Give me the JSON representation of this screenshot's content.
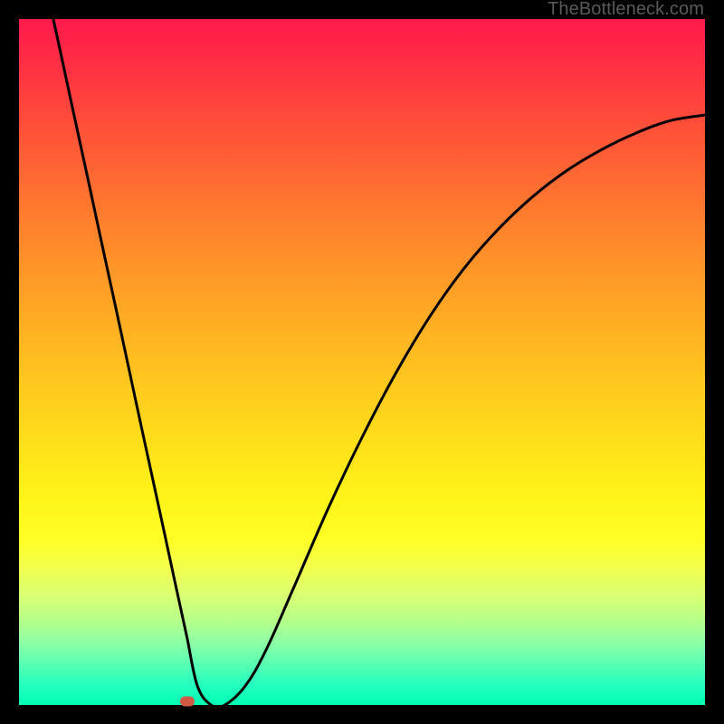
{
  "watermark": "TheBottleneck.com",
  "chart_data": {
    "type": "line",
    "title": "",
    "xlabel": "",
    "ylabel": "",
    "xlim": [
      0,
      100
    ],
    "ylim": [
      0,
      100
    ],
    "series": [
      {
        "name": "curve",
        "x": [
          5.0,
          6,
          8,
          10,
          12,
          14,
          16,
          18,
          20,
          21.3,
          22.5,
          23.5,
          24.5,
          26,
          28,
          30,
          33,
          36,
          40,
          45,
          50,
          55,
          60,
          65,
          70,
          75,
          80,
          85,
          90,
          95,
          100
        ],
        "y": [
          100,
          95.4,
          86.1,
          76.9,
          67.6,
          58.4,
          49.1,
          39.8,
          30.6,
          24.6,
          19.0,
          14.4,
          9.8,
          2.8,
          0.0,
          0.0,
          2.8,
          8.0,
          17.0,
          28.5,
          39.0,
          48.5,
          56.8,
          63.8,
          69.5,
          74.2,
          78.0,
          81.0,
          83.4,
          85.2,
          86.0
        ]
      }
    ],
    "marker": {
      "x": 24.5,
      "y": 0.5,
      "color": "#d15a46"
    },
    "background_gradient": {
      "top": "#ff1a4d",
      "bottom": "#00ffb3"
    }
  }
}
